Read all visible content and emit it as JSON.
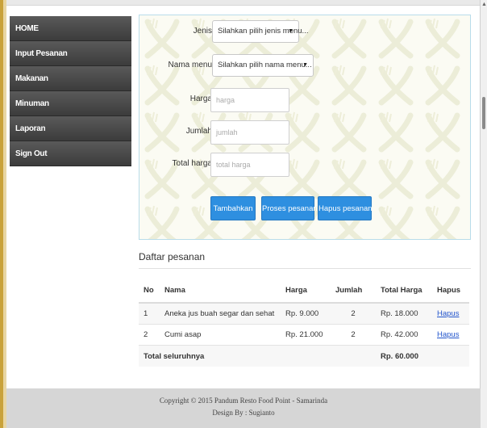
{
  "sidebar": {
    "items": [
      {
        "label": "HOME"
      },
      {
        "label": "Input Pesanan"
      },
      {
        "label": "Makanan"
      },
      {
        "label": "Minuman"
      },
      {
        "label": "Laporan"
      },
      {
        "label": "Sign Out"
      }
    ]
  },
  "form": {
    "jenis": {
      "label": "Jenis",
      "value": "Silahkan pilih jenis menu..."
    },
    "nama_menu": {
      "label": "Nama menu",
      "value": "Silahkan pilih nama menu..."
    },
    "harga": {
      "label": "Harga",
      "placeholder": "harga"
    },
    "jumlah": {
      "label": "Jumlah",
      "placeholder": "jumlah"
    },
    "total_harga": {
      "label": "Total harga",
      "placeholder": "total harga"
    },
    "buttons": {
      "tambahkan": "Tambahkan",
      "proses": "Proses pesanan",
      "hapus": "Hapus pesanan"
    },
    "accent_color": "#2e8fe0"
  },
  "orders": {
    "title": "Daftar pesanan",
    "columns": [
      "No",
      "Nama",
      "Harga",
      "Jumlah",
      "Total Harga",
      "Hapus"
    ],
    "rows": [
      {
        "no": "1",
        "nama": "Aneka jus buah segar dan sehat",
        "harga": "Rp. 9.000",
        "jumlah": "2",
        "total": "Rp. 18.000",
        "hapus": "Hapus"
      },
      {
        "no": "2",
        "nama": "Cumi asap",
        "harga": "Rp. 21.000",
        "jumlah": "2",
        "total": "Rp. 42.000",
        "hapus": "Hapus"
      }
    ],
    "total_label": "Total seluruhnya",
    "total_value": "Rp. 60.000"
  },
  "footer": {
    "copyright": "Copyright © 2015 Pandum Resto Food Point - Samarinda",
    "design": "Design By : Sugianto"
  }
}
